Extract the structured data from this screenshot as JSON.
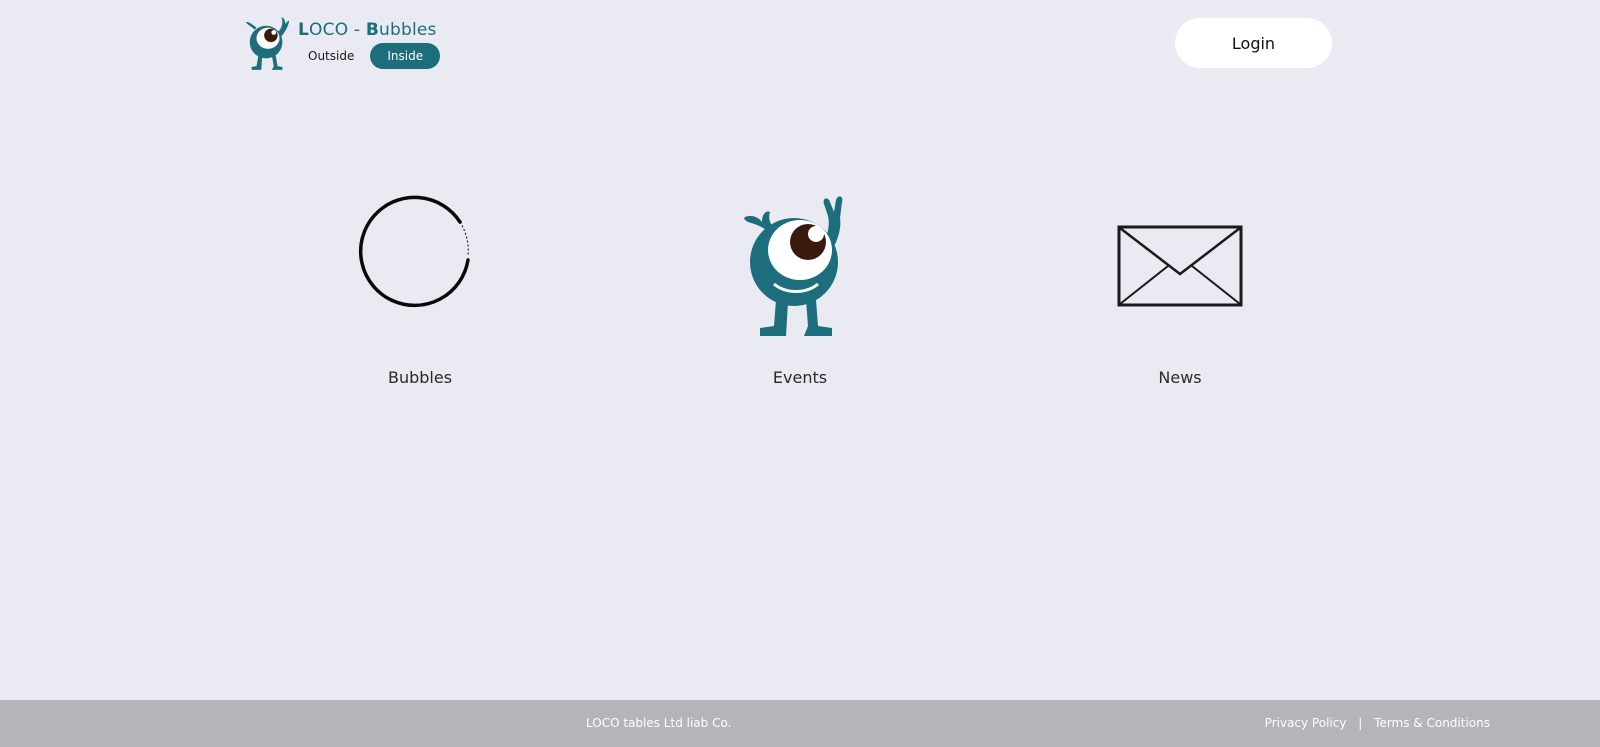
{
  "header": {
    "brand": {
      "logo_icon": "mascot-icon",
      "title_initial_1": "L",
      "title_part_1": "OCO - ",
      "title_initial_2": "B",
      "title_part_2": "ubbles"
    },
    "toggle": {
      "outside_label": "Outside",
      "inside_label": "Inside",
      "selected": "Inside"
    },
    "login_label": "Login"
  },
  "cards": [
    {
      "icon": "bubble-circle-icon",
      "label": "Bubbles"
    },
    {
      "icon": "mascot-icon",
      "label": "Events"
    },
    {
      "icon": "envelope-icon",
      "label": "News"
    }
  ],
  "footer": {
    "copyright": "LOCO tables Ltd liab Co.",
    "links": [
      {
        "label": "Privacy Policy"
      },
      {
        "label": "Terms & Conditions"
      }
    ],
    "separator": "|"
  },
  "colors": {
    "brand_teal": "#1c6e7d",
    "background": "#e9eaf2",
    "footer_bg": "#b4b5ba",
    "eye_dark": "#3a1a0c"
  }
}
